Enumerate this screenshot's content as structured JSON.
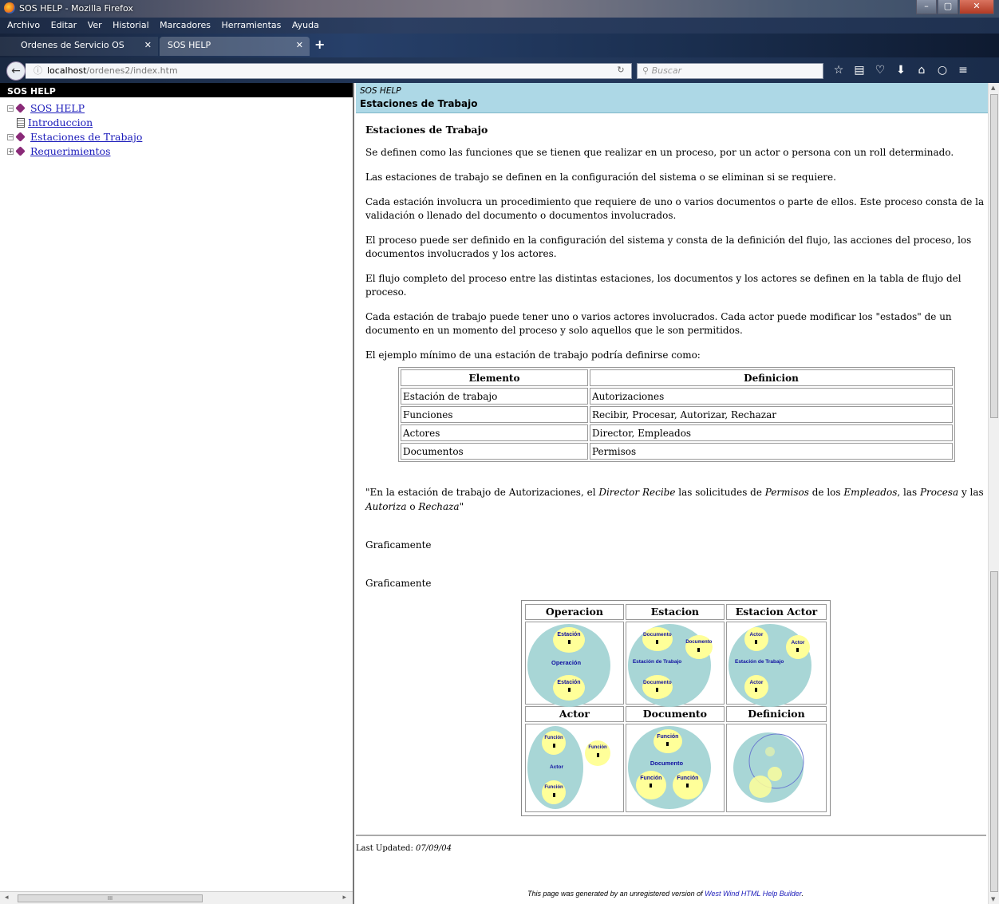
{
  "window": {
    "title": "SOS HELP - Mozilla Firefox"
  },
  "menu": [
    "Archivo",
    "Editar",
    "Ver",
    "Historial",
    "Marcadores",
    "Herramientas",
    "Ayuda"
  ],
  "tabs": [
    {
      "label": "Ordenes de Servicio OS"
    },
    {
      "label": "SOS HELP"
    }
  ],
  "url": {
    "host": "localhost",
    "path": "/ordenes2/index.htm"
  },
  "search": {
    "placeholder": "Buscar"
  },
  "sidebar": {
    "header": "SOS HELP",
    "items": [
      {
        "label": "SOS HELP"
      },
      {
        "label": "Introduccion"
      },
      {
        "label": "Estaciones de Trabajo"
      },
      {
        "label": "Requerimientos"
      }
    ]
  },
  "page": {
    "breadcrumb": "SOS HELP",
    "title": "Estaciones de Trabajo",
    "heading": "Estaciones de Trabajo",
    "paragraphs": [
      "Se definen como las funciones que se tienen que realizar en un proceso, por un actor o persona con un roll determinado.",
      "Las estaciones de trabajo se definen en la configuración del sistema o se eliminan si se requiere.",
      "Cada estación involucra un procedimiento que requiere de uno o varios documentos o parte de ellos. Este proceso consta de la validación o llenado del documento o documentos involucrados.",
      "El proceso puede ser definido en la configuración del sistema y consta de la definición del flujo, las acciones del proceso, los documentos involucrados y los actores.",
      "El flujo completo del proceso entre las distintas estaciones, los documentos y los actores se definen en la tabla de flujo del proceso.",
      "Cada estación de trabajo puede tener uno o varios actores involucrados. Cada actor puede modificar los \"estados\" de un documento en un momento del proceso y solo aquellos que le son permitidos.",
      "El ejemplo mínimo de una estación de trabajo podría definirse como:"
    ],
    "table": {
      "headers": [
        "Elemento",
        "Definicion"
      ],
      "rows": [
        [
          "Estación de trabajo",
          "Autorizaciones"
        ],
        [
          "Funciones",
          "Recibir, Procesar, Autorizar, Rechazar"
        ],
        [
          "Actores",
          "Director, Empleados"
        ],
        [
          "Documentos",
          "Permisos"
        ]
      ]
    },
    "quote": {
      "p1": "\"En la estación de trabajo de Autorizaciones, el ",
      "director": "Director",
      "recibe": "Recibe",
      "p2": " las solicitudes de ",
      "permisos": "Permisos",
      "p3": " de los ",
      "empleados": "Empleados",
      "p4": ", las ",
      "procesa": "Procesa",
      "p5": " y las ",
      "autoriza": "Autoriza",
      "p6": " o ",
      "rechaza": "Rechaza",
      "p7": "\""
    },
    "graficamente_1": "Graficamente",
    "graficamente_2": "Graficamente",
    "diagram": {
      "headers": [
        "Operacion",
        "Estacion",
        "Estacion Actor",
        "Actor",
        "Documento",
        "Definicion"
      ],
      "operacion": {
        "top": "Estación",
        "center": "Operación",
        "bottom": "Estación"
      },
      "estacion": {
        "doc1": "Documento",
        "doc2": "Documento",
        "center": "Estación de Trabajo",
        "doc3": "Documento"
      },
      "estacion_actor": {
        "a1": "Actor",
        "a2": "Actor",
        "center": "Estación de Trabajo",
        "a3": "Actor"
      },
      "actor": {
        "f1": "Función",
        "f2": "Función",
        "center": "Actor",
        "f3": "Función"
      },
      "documento": {
        "f1": "Función",
        "center": "Documento",
        "f2": "Función",
        "f3": "Función"
      }
    },
    "updated_label": "Last Updated: ",
    "updated_date": "07/09/04",
    "generated_text": "This page was generated by an unregistered version of ",
    "generated_link": "West Wind HTML Help Builder",
    "generated_end": "."
  },
  "colors": {
    "header_bg": "#add8e6",
    "bubble": "#a8d6d6",
    "node": "#ffff99"
  }
}
